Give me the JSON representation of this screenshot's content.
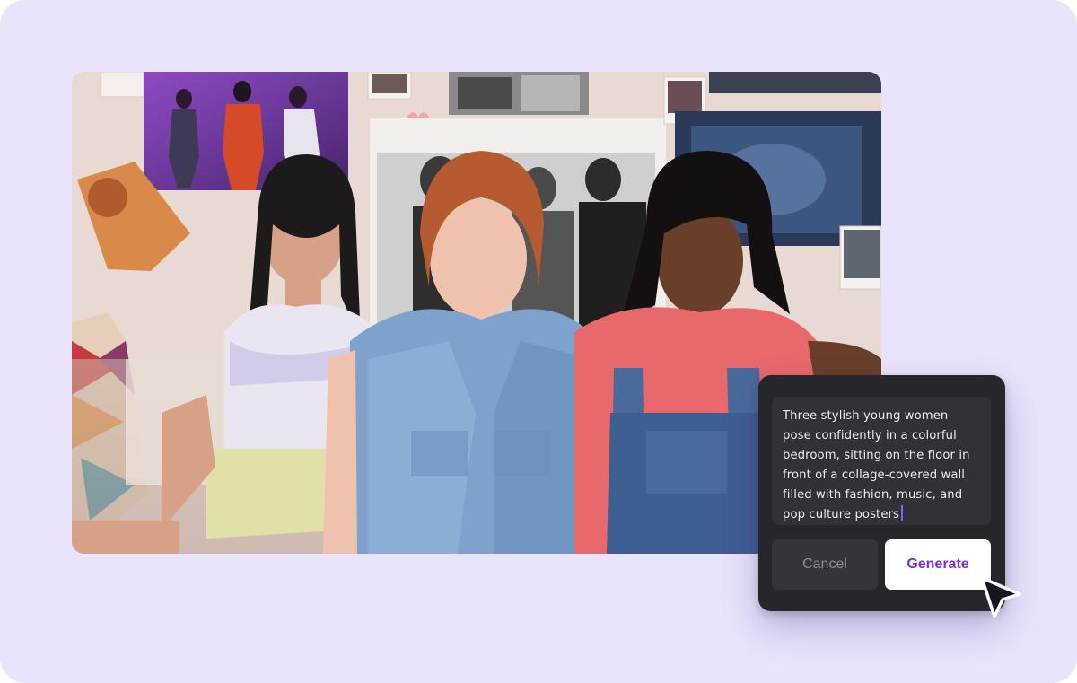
{
  "background_color": "#e9e3fc",
  "photo": {
    "description_icon": "photo-image",
    "wall_color": "#e6d6cf",
    "shirt_colors": [
      "#e8e2f0",
      "#7ea2cc",
      "#e8696b"
    ]
  },
  "dialog": {
    "prompt_text": "Three stylish young women pose confidently in a colorful bedroom, sitting on the floor in front of a collage-covered wall filled with fashion, music, and pop culture posters",
    "cancel_label": "Cancel",
    "generate_label": "Generate",
    "accent_color": "#7c2fe0",
    "caret_color": "#8b5cf6"
  },
  "cursor_icon": "arrow-pointer-icon"
}
